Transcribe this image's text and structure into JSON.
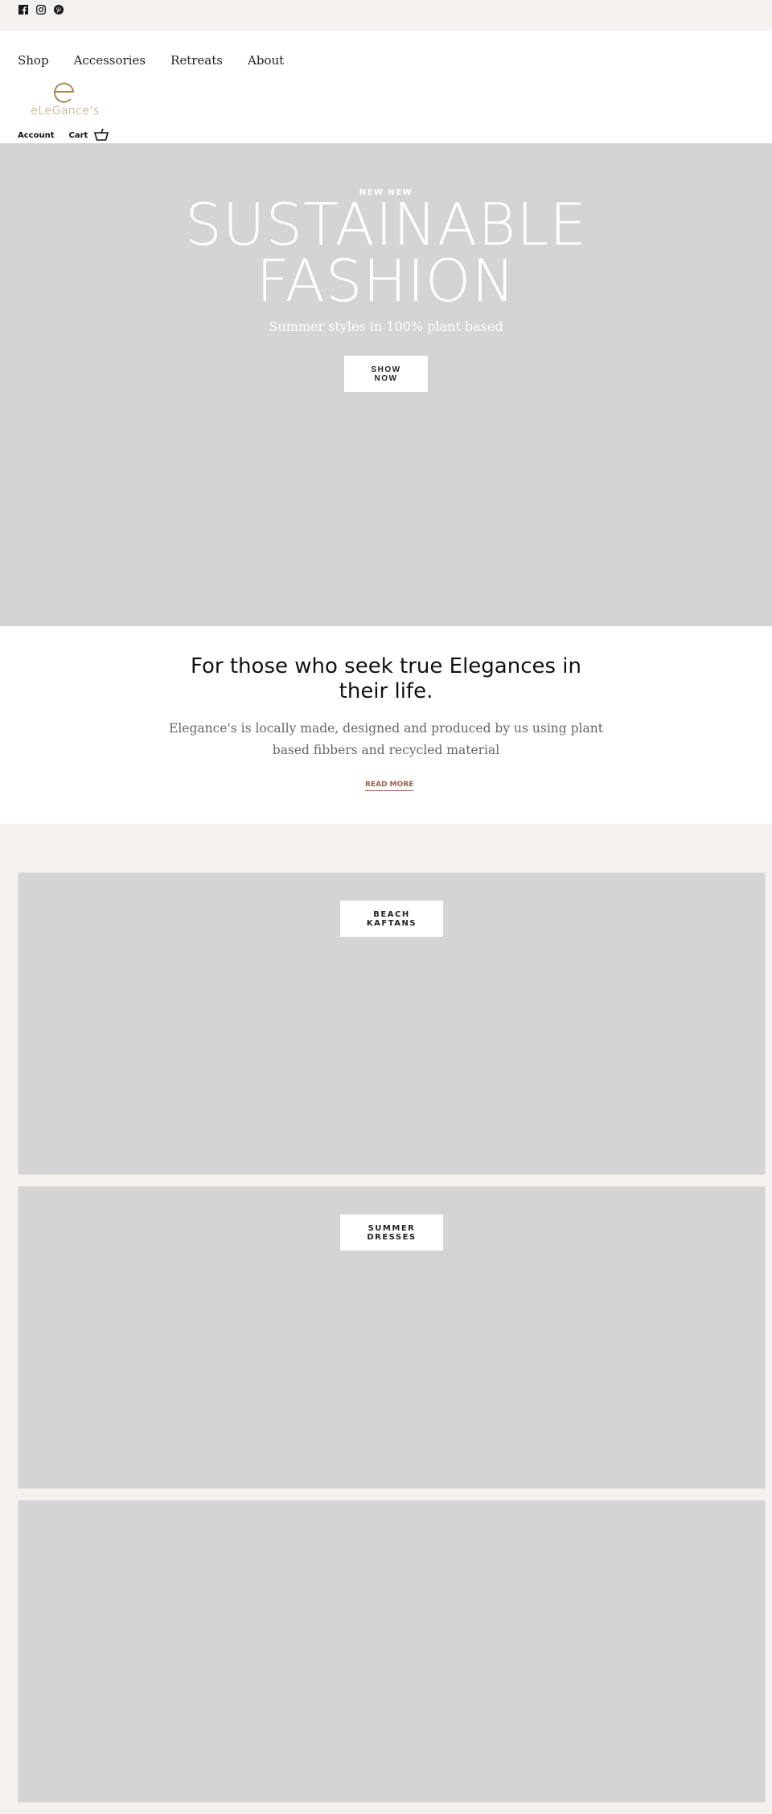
{
  "topbar": {
    "social": [
      {
        "name": "facebook-icon",
        "label": "Facebook"
      },
      {
        "name": "instagram-icon",
        "label": "Instagram"
      },
      {
        "name": "pinterest-icon",
        "label": "Pinterest"
      }
    ]
  },
  "nav": {
    "items": [
      {
        "label": "Shop"
      },
      {
        "label": "Accessories"
      },
      {
        "label": "Retreats"
      },
      {
        "label": "About"
      }
    ]
  },
  "brand": {
    "name": "eLeGance's",
    "color": "#a8884f"
  },
  "header": {
    "account_label": "Account",
    "cart_label": "Cart"
  },
  "hero": {
    "eyebrow": "NEW NEW",
    "title_line1": "SUSTAINABLE",
    "title_line2": "FASHION",
    "subtitle": "Summer styles in 100% plant based",
    "button_line1": "SHOW",
    "button_line2": "NOW"
  },
  "intro": {
    "heading": "For those who seek true Elegances in their life.",
    "body": "Elegance's is locally made, designed and produced by us using plant based fibbers and recycled material",
    "link": "READ MORE",
    "link_color": "#a25d4e"
  },
  "collections": [
    {
      "line1": "BEACH",
      "line2": "KAFTANS"
    },
    {
      "line1": "SUMMER",
      "line2": "DRESSES"
    },
    {
      "line1": "",
      "line2": ""
    }
  ]
}
